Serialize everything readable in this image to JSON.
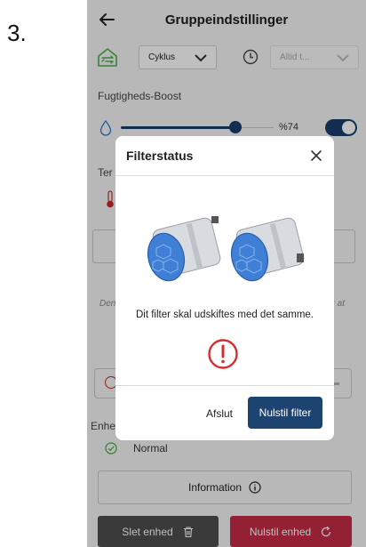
{
  "step_number": "3.",
  "header": {
    "title": "Gruppeindstillinger"
  },
  "mode": {
    "selected": "Cyklus"
  },
  "time": {
    "selected": "Altid t..."
  },
  "humidity": {
    "label": "Fugtigheds-Boost",
    "value_text": "%74",
    "level": 0.74,
    "toggle_on": true
  },
  "temperature": {
    "label_partial": "Ter"
  },
  "background": {
    "italic_left": "Den",
    "italic_right": "or at",
    "units_label_partial": "Enhe"
  },
  "status": {
    "normal_label": "Normal"
  },
  "info_button": {
    "label": "Information"
  },
  "delete_button": {
    "label": "Slet enhed"
  },
  "reset_button": {
    "label": "Nulstil enhed"
  },
  "colors": {
    "primary": "#1d4370",
    "danger": "#c62c45",
    "dark": "#4e4e4e"
  },
  "modal": {
    "title": "Filterstatus",
    "message": "Dit filter skal udskiftes med det samme.",
    "cancel_label": "Afslut",
    "confirm_label": "Nulstil filter"
  }
}
